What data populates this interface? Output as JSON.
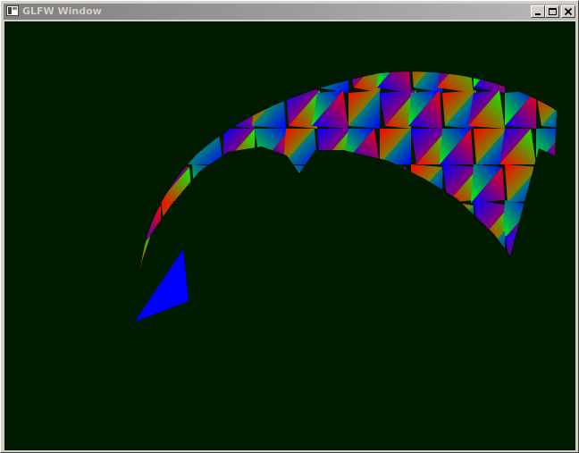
{
  "window": {
    "title": "GLFW Window",
    "controls": [
      "minimize",
      "maximize",
      "close"
    ]
  },
  "viewport": {
    "background_color": "#001a00",
    "mesh_colors": [
      "#ff0000",
      "#00ff00",
      "#0000ff"
    ],
    "flat_triangle_color": "#0000ff"
  }
}
